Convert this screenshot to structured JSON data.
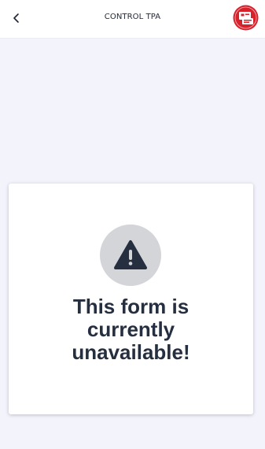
{
  "header": {
    "title": "CONTROL TPA",
    "back_icon": "chevron-left-icon",
    "logo_icon": "brand-logo-icon",
    "logo_color": "#d7222c"
  },
  "card": {
    "icon": "warning-triangle-icon",
    "message": "This form is currently unavailable!",
    "icon_bg": "#d4d5d9",
    "text_color": "#262f40"
  },
  "colors": {
    "page_bg": "#f3f3fc",
    "header_bg": "#ffffff"
  }
}
